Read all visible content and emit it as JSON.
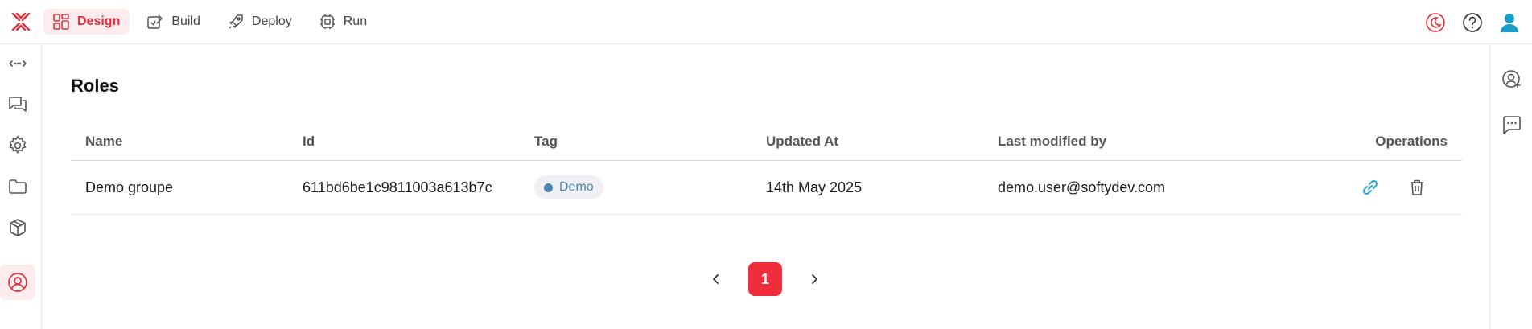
{
  "topnav": {
    "items": [
      {
        "label": "Design",
        "icon": "design-grid-icon",
        "active": true
      },
      {
        "label": "Build",
        "icon": "build-icon",
        "active": false
      },
      {
        "label": "Deploy",
        "icon": "rocket-icon",
        "active": false
      },
      {
        "label": "Run",
        "icon": "run-chip-icon",
        "active": false
      }
    ]
  },
  "sidebar": {
    "items": [
      {
        "name": "api-icon"
      },
      {
        "name": "chat-icon"
      },
      {
        "name": "settings-gear-icon"
      },
      {
        "name": "folder-icon"
      },
      {
        "name": "package-box-icon"
      },
      {
        "name": "roles-user-icon",
        "active": true
      }
    ]
  },
  "page": {
    "title": "Roles"
  },
  "table": {
    "columns": [
      "Name",
      "Id",
      "Tag",
      "Updated At",
      "Last modified by",
      "Operations"
    ],
    "rows": [
      {
        "name": "Demo groupe",
        "id": "611bd6be1c9811003a613b7c",
        "tag": "Demo",
        "updated_at": "14th May 2025",
        "last_modified_by": "demo.user@softydev.com"
      }
    ]
  },
  "pagination": {
    "current_page": "1"
  },
  "colors": {
    "accent": "#f02d3a",
    "accent_soft": "#fdecee",
    "tag_text": "#4a86b0",
    "link_icon": "#2aa8d8"
  }
}
